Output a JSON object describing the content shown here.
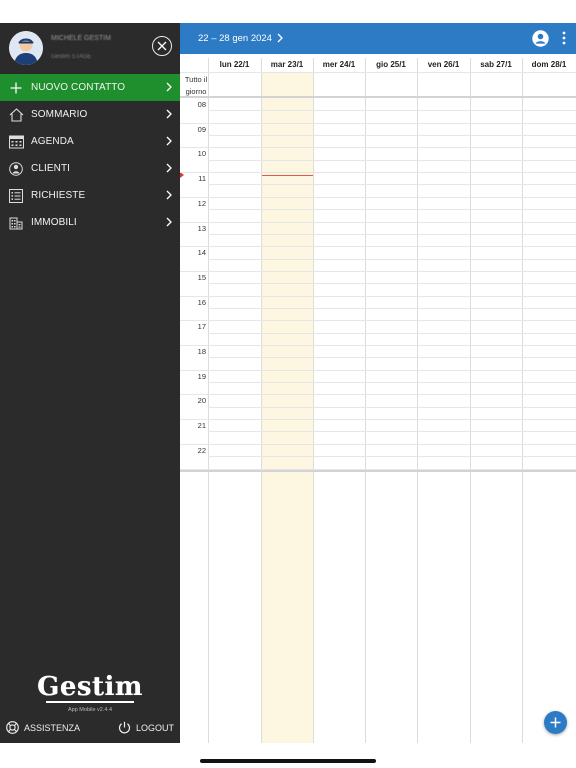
{
  "sidebar": {
    "user": {
      "name": "MICHELE GESTIM",
      "org": "Gestim STAGE"
    },
    "menu": [
      {
        "label": "NUOVO CONTATTO",
        "icon": "plus-icon"
      },
      {
        "label": "SOMMARIO",
        "icon": "home-icon"
      },
      {
        "label": "AGENDA",
        "icon": "calendar-icon"
      },
      {
        "label": "CLIENTI",
        "icon": "person-icon"
      },
      {
        "label": "RICHIESTE",
        "icon": "list-icon"
      },
      {
        "label": "IMMOBILI",
        "icon": "building-icon"
      }
    ],
    "brand": "Gestim",
    "version": "App Mobile v2.4.4",
    "assist_label": "ASSISTENZA",
    "logout_label": "LOGOUT"
  },
  "calendar": {
    "range": "22 – 28 gen 2024",
    "days": [
      "lun 22/1",
      "mar 23/1",
      "mer 24/1",
      "gio 25/1",
      "ven 26/1",
      "sab 27/1",
      "dom 28/1"
    ],
    "today_index": 1,
    "all_day_label": "Tutto il giorno",
    "hours": [
      "08",
      "09",
      "10",
      "11",
      "12",
      "13",
      "14",
      "15",
      "16",
      "17",
      "18",
      "19",
      "20",
      "21",
      "22"
    ],
    "current_hour": "11"
  },
  "colors": {
    "sidebar_bg": "#2b2b2b",
    "primary_green": "#1f8e2c",
    "header_blue": "#2c7bc4",
    "today_bg": "#fdf6e1",
    "now_line": "#e25a4c"
  }
}
